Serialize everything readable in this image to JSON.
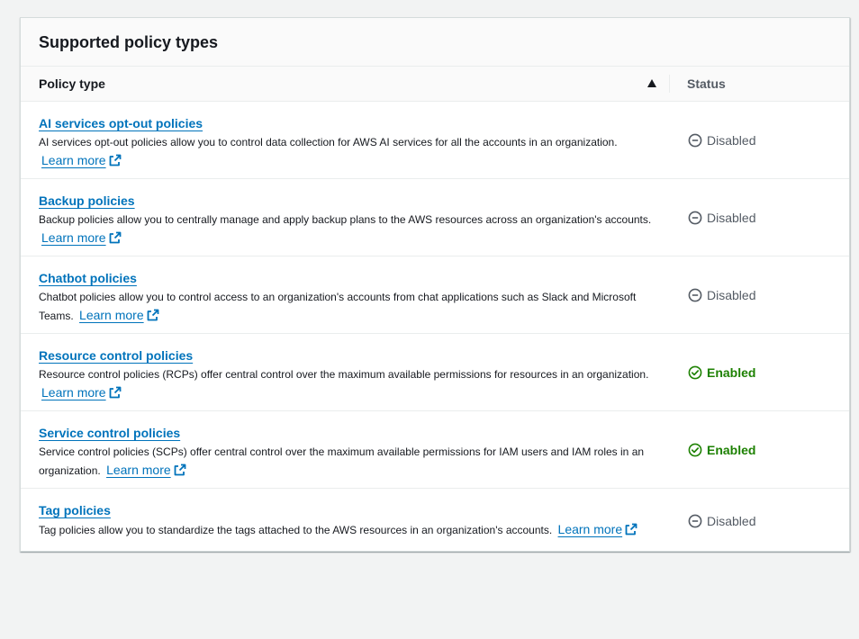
{
  "panel": {
    "title": "Supported policy types"
  },
  "table": {
    "columns": {
      "policy_type": "Policy type",
      "status": "Status"
    },
    "learn_more_label": "Learn more",
    "rows": [
      {
        "name": "AI services opt-out policies",
        "desc": "AI services opt-out policies allow you to control data collection for AWS AI services for all the accounts in an organization.",
        "status": "Disabled",
        "status_type": "disabled"
      },
      {
        "name": "Backup policies",
        "desc": "Backup policies allow you to centrally manage and apply backup plans to the AWS resources across an organization's accounts.",
        "status": "Disabled",
        "status_type": "disabled"
      },
      {
        "name": "Chatbot policies",
        "desc": "Chatbot policies allow you to control access to an organization's accounts from chat applications such as Slack and Microsoft Teams.",
        "status": "Disabled",
        "status_type": "disabled"
      },
      {
        "name": "Resource control policies",
        "desc": "Resource control policies (RCPs) offer central control over the maximum available permissions for resources in an organization.",
        "status": "Enabled",
        "status_type": "enabled"
      },
      {
        "name": "Service control policies",
        "desc": "Service control policies (SCPs) offer central control over the maximum available permissions for IAM users and IAM roles in an organization.",
        "status": "Enabled",
        "status_type": "enabled"
      },
      {
        "name": "Tag policies",
        "desc": "Tag policies allow you to standardize the tags attached to the AWS resources in an organization's accounts.",
        "status": "Disabled",
        "status_type": "disabled"
      }
    ]
  },
  "colors": {
    "link": "#0073bb",
    "enabled": "#1d8102",
    "disabled": "#545b64"
  }
}
